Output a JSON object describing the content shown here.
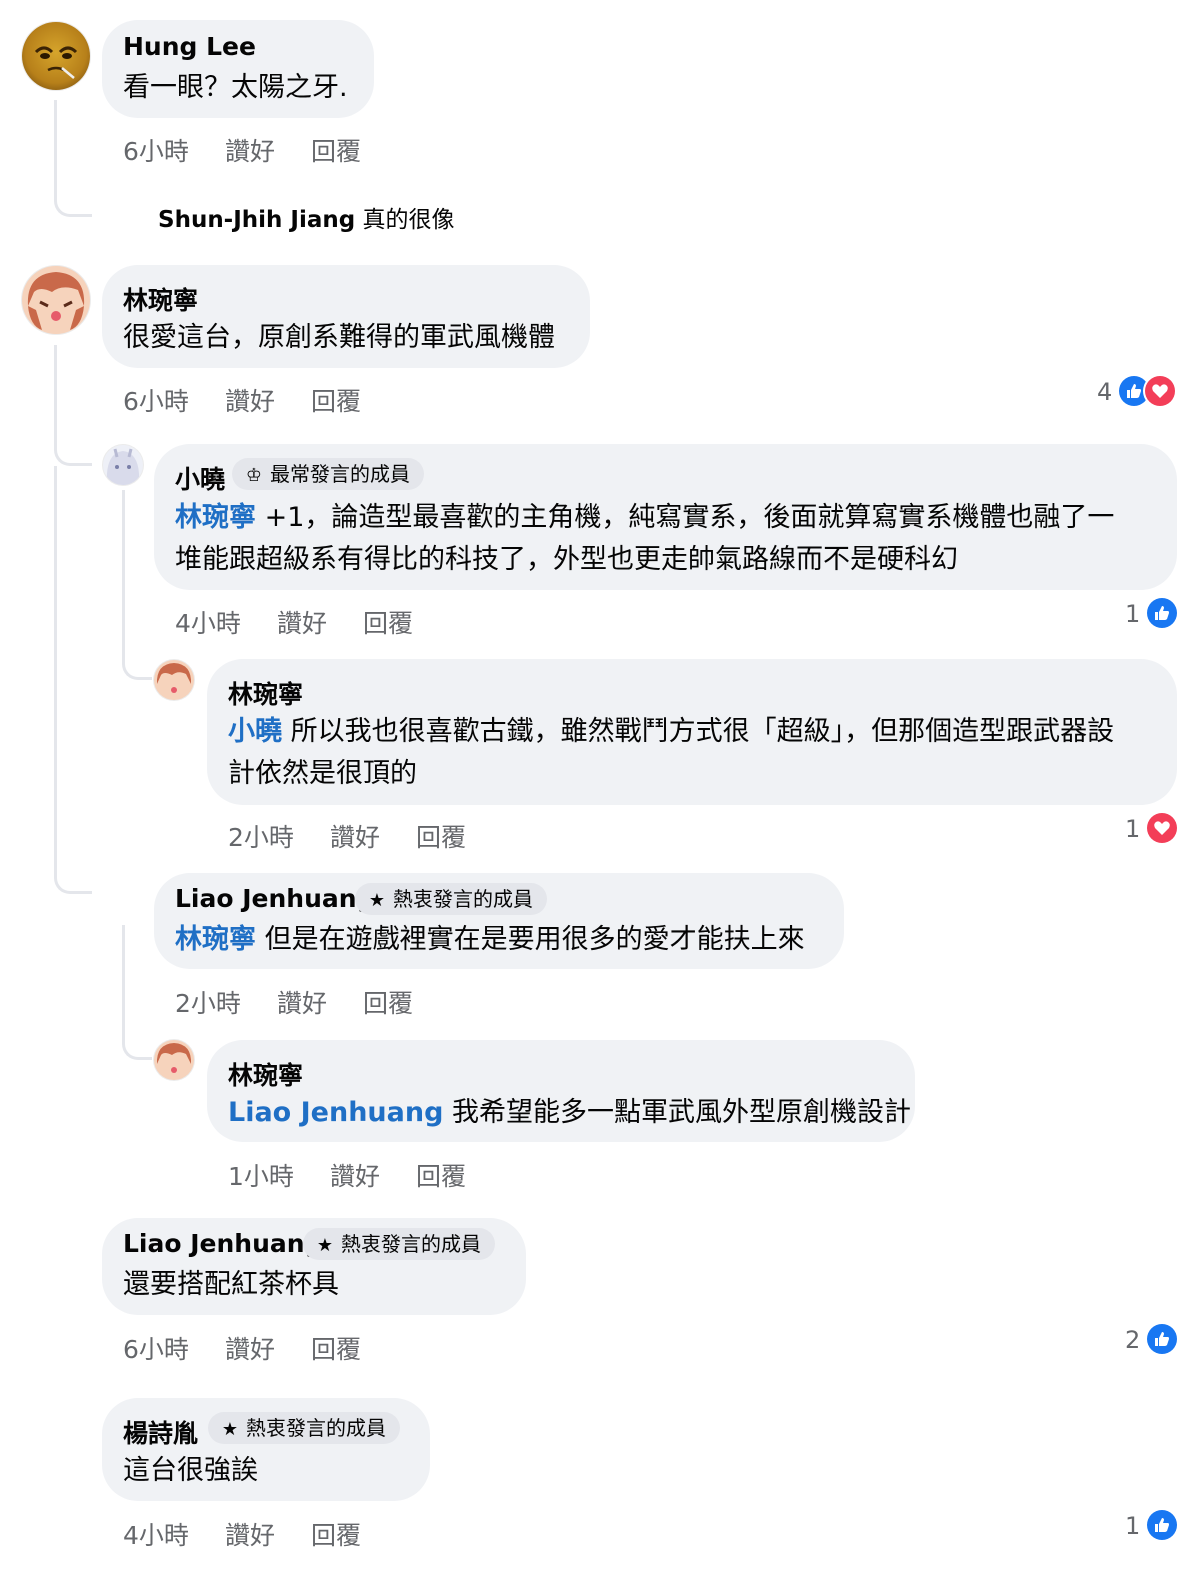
{
  "comments": [
    {
      "author": "Hung Lee",
      "text": "看一眼？太陽之牙.",
      "time": "6小時",
      "like_label": "讚好",
      "reply_label": "回覆",
      "reply_preview": {
        "author": "Shun-Jhih Jiang",
        "text": "真的很像"
      }
    },
    {
      "author": "林琬寧",
      "text": "很愛這台，原創系難得的軍武風機體",
      "time": "6小時",
      "like_label": "讚好",
      "reply_label": "回覆",
      "reactions": {
        "count": "4",
        "types": [
          "like-icon",
          "love-icon"
        ]
      }
    },
    {
      "author": "小曉",
      "badge": "最常發言的成員",
      "badge_icon": "top-contributor-icon",
      "mention": "林琬寧",
      "text_line1": " +1，論造型最喜歡的主角機，純寫實系，後面就算寫實系機體也融了一",
      "text_line2": "堆能跟超級系有得比的科技了，外型也更走帥氣路線而不是硬科幻",
      "time": "4小時",
      "like_label": "讚好",
      "reply_label": "回覆",
      "reactions": {
        "count": "1",
        "types": [
          "like-icon"
        ]
      }
    },
    {
      "author": "林琬寧",
      "mention": "小曉",
      "text_line1": " 所以我也很喜歡古鐵，雖然戰鬥方式很「超級」，但那個造型跟武器設",
      "text_line2": "計依然是很頂的",
      "time": "2小時",
      "like_label": "讚好",
      "reply_label": "回覆",
      "reactions": {
        "count": "1",
        "types": [
          "love-icon"
        ]
      }
    },
    {
      "author": "Liao Jenhuang",
      "badge": "熱衷發言的成員",
      "badge_icon": "star-icon",
      "mention": "林琬寧",
      "text": " 但是在遊戲裡實在是要用很多的愛才能扶上來",
      "time": "2小時",
      "like_label": "讚好",
      "reply_label": "回覆"
    },
    {
      "author": "林琬寧",
      "mention": "Liao Jenhuang",
      "text": " 我希望能多一點軍武風外型原創機設計",
      "time": "1小時",
      "like_label": "讚好",
      "reply_label": "回覆"
    },
    {
      "author": "Liao Jenhuang",
      "badge": "熱衷發言的成員",
      "badge_icon": "star-icon",
      "text": "還要搭配紅茶杯具",
      "time": "6小時",
      "like_label": "讚好",
      "reply_label": "回覆",
      "reactions": {
        "count": "2",
        "types": [
          "like-icon"
        ]
      }
    },
    {
      "author": "楊詩胤",
      "badge": "熱衷發言的成員",
      "badge_icon": "star-icon",
      "text": "這台很強誒",
      "time": "4小時",
      "like_label": "讚好",
      "reply_label": "回覆",
      "reactions": {
        "count": "1",
        "types": [
          "like-icon"
        ]
      }
    }
  ],
  "colors": {
    "bubble": "#f0f2f5",
    "mention": "#1f6fc5",
    "like": "#1877f2",
    "love": "#f33e58",
    "meta": "#65676b"
  }
}
